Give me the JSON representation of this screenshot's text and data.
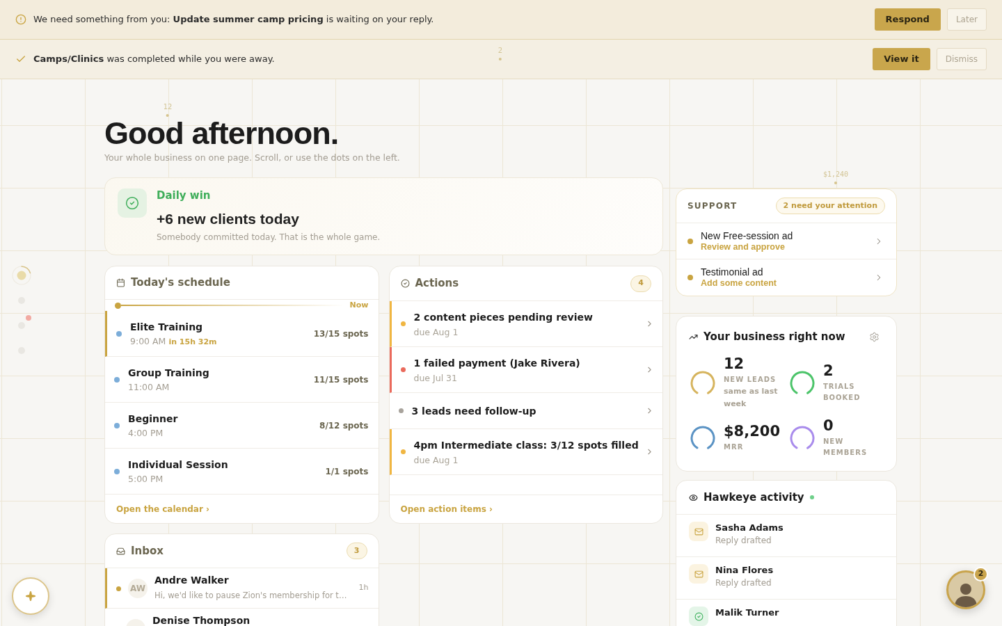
{
  "banners": [
    {
      "kind": "request",
      "text": "We need something from you: **Update summer camp pricing** is waiting on your reply.",
      "primary": "Respond",
      "secondary": "Later"
    },
    {
      "kind": "done",
      "text": "**Camps/Clinics** was completed while you were away.",
      "primary": "View it",
      "secondary": "Dismiss"
    }
  ],
  "background_markers": [
    {
      "label": "12"
    },
    {
      "label": "2"
    },
    {
      "label": "$1,240"
    }
  ],
  "section_dots": [
    {
      "selected": true,
      "alert": false
    },
    {
      "selected": false,
      "alert": false
    },
    {
      "selected": false,
      "alert": true
    },
    {
      "selected": false,
      "alert": false
    }
  ],
  "greeting": {
    "title": "Good afternoon.",
    "subtitle": "Your whole business on one page. Scroll, or use the dots on the left."
  },
  "daily_win": {
    "label": "Daily win",
    "headline": "+6 new clients today",
    "note": "Somebody committed today. That is the whole game."
  },
  "schedule": {
    "title": "Today's schedule",
    "now_label": "Now",
    "items": [
      {
        "name": "Elite Training",
        "time": "9:00 AM",
        "countdown": "in 15h 32m",
        "spots": "13/15 spots",
        "next": true
      },
      {
        "name": "Group Training",
        "time": "11:00 AM",
        "spots": "11/15 spots",
        "next": false
      },
      {
        "name": "Beginner",
        "time": "4:00 PM",
        "spots": "8/12 spots",
        "next": false
      },
      {
        "name": "Individual Session",
        "time": "5:00 PM",
        "spots": "1/1 spots",
        "next": false
      }
    ],
    "link": "Open the calendar ›"
  },
  "actions": {
    "title": "Actions",
    "count": "4",
    "items": [
      {
        "title": "2 content pieces pending review",
        "due": "due Aug 1",
        "color": "#f0b642",
        "flagged": true
      },
      {
        "title": "1 failed payment (Jake Rivera)",
        "due": "due Jul 31",
        "color": "#ea6a5c",
        "flagged": true
      },
      {
        "title": "3 leads need follow-up",
        "color": "#a8a39c",
        "flagged": false
      },
      {
        "title": "4pm Intermediate class: 3/12 spots filled",
        "due": "due Aug 1",
        "color": "#f0b642",
        "flagged": true
      }
    ],
    "link": "Open action items ›"
  },
  "inbox": {
    "title": "Inbox",
    "count": "3",
    "messages": [
      {
        "initials": "AW",
        "name": "Andre Walker",
        "preview": "Hi, we'd like to pause Zion's membership for t…",
        "time": "1h",
        "unread": true
      },
      {
        "name": "Denise Thompson",
        "unread": false
      }
    ]
  },
  "support": {
    "title": "SUPPORT",
    "badge": "2 need your attention",
    "items": [
      {
        "title": "New Free-session ad",
        "subtitle": "Review and approve"
      },
      {
        "title": "Testimonial ad",
        "subtitle": "Add some content"
      }
    ]
  },
  "business": {
    "title": "Your business right now",
    "metrics": [
      {
        "value": "12",
        "label": "NEW LEADS",
        "note": "same as last week",
        "color": "#d6b45e"
      },
      {
        "value": "2",
        "label": "TRIALS BOOKED",
        "color": "#4cc46a"
      },
      {
        "value": "$8,200",
        "label": "MRR",
        "color": "#5b93c4"
      },
      {
        "value": "0",
        "label": "NEW MEMBERS",
        "color": "#a98cec"
      }
    ]
  },
  "hawkeye": {
    "title": "Hawkeye activity",
    "live": true,
    "items": [
      {
        "kind": "draft",
        "name": "Sasha Adams",
        "status": "Reply drafted"
      },
      {
        "kind": "draft",
        "name": "Nina Flores",
        "status": "Reply drafted"
      },
      {
        "kind": "booking",
        "name": "Malik Turner"
      }
    ]
  },
  "assistant": {
    "badge": "2"
  }
}
